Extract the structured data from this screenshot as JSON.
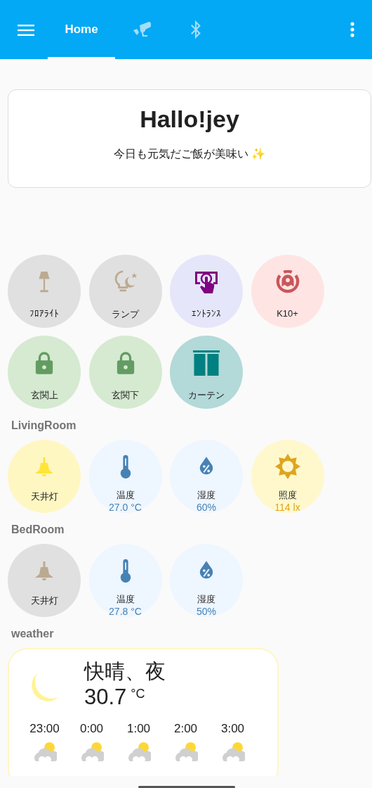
{
  "header": {
    "tabs": [
      {
        "kind": "label",
        "label": "Home",
        "selected": true
      },
      {
        "kind": "camera",
        "selected": false
      },
      {
        "kind": "bluetooth",
        "selected": false
      }
    ]
  },
  "greeting": {
    "title": "Hallo!jey",
    "message": "今日も元気だご飯が美味い ✨"
  },
  "devices": [
    {
      "kind": "floor-lamp",
      "name": "ﾌﾛｱﾗｲﾄ",
      "on": false
    },
    {
      "kind": "night-lamp",
      "name": "ランプ",
      "on": false
    },
    {
      "kind": "entrance",
      "name": "ｴﾝﾄﾗﾝｽ"
    },
    {
      "kind": "vacuum",
      "name": "K10+"
    },
    {
      "kind": "lock",
      "name": "玄関上",
      "locked": true
    },
    {
      "kind": "lock",
      "name": "玄関下",
      "locked": true
    },
    {
      "kind": "curtain",
      "name": "カーテン"
    }
  ],
  "rooms": [
    {
      "title": "LivingRoom",
      "tiles": [
        {
          "kind": "ceiling-light",
          "name": "天井灯",
          "on": true
        },
        {
          "kind": "temperature",
          "name": "温度",
          "value": "27.0 °C"
        },
        {
          "kind": "humidity",
          "name": "湿度",
          "value": "60%"
        },
        {
          "kind": "illuminance",
          "name": "照度",
          "value": "114 lx"
        }
      ]
    },
    {
      "title": "BedRoom",
      "tiles": [
        {
          "kind": "ceiling-light",
          "name": "天井灯",
          "on": false
        },
        {
          "kind": "temperature",
          "name": "温度",
          "value": "27.8 °C"
        },
        {
          "kind": "humidity",
          "name": "湿度",
          "value": "50%"
        }
      ]
    }
  ],
  "weather": {
    "title": "weather",
    "condition": "快晴、夜",
    "temperature": "30.7",
    "unit": "°C",
    "kind": "clear-night",
    "forecast": [
      {
        "time": "23:00",
        "kind": "partly-cloudy"
      },
      {
        "time": "0:00",
        "kind": "partly-cloudy"
      },
      {
        "time": "1:00",
        "kind": "partly-cloudy"
      },
      {
        "time": "2:00",
        "kind": "partly-cloudy"
      },
      {
        "time": "3:00",
        "kind": "partly-cloudy"
      }
    ]
  }
}
